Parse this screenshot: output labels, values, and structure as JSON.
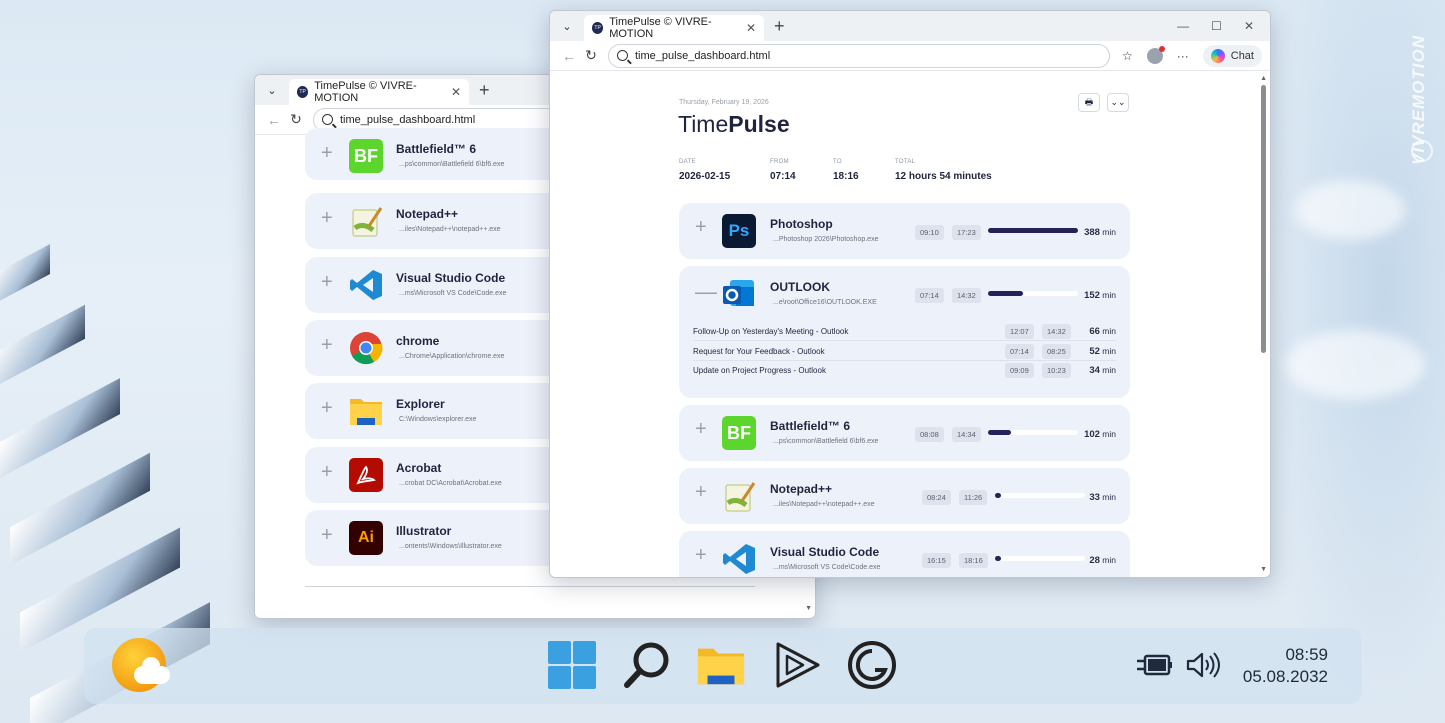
{
  "desktop": {
    "watermark": "VIVREMOTION"
  },
  "back_window": {
    "tab_title": "TimePulse © VIVRE-MOTION",
    "url": "time_pulse_dashboard.html",
    "apps": [
      {
        "name": "Battlefield™ 6",
        "path": "...ps\\common\\Battlefield 6\\bf6.exe",
        "icon": "battlefield-icon"
      },
      {
        "name": "Notepad++",
        "path": "...iles\\Notepad++\\notepad++.exe",
        "icon": "notepad-plus-plus-icon"
      },
      {
        "name": "Visual Studio Code",
        "path": "...ms\\Microsoft VS Code\\Code.exe",
        "icon": "vscode-icon"
      },
      {
        "name": "chrome",
        "path": "...Chrome\\Application\\chrome.exe",
        "icon": "chrome-icon"
      },
      {
        "name": "Explorer",
        "path": "C:\\Windows\\explorer.exe",
        "icon": "explorer-icon"
      },
      {
        "name": "Acrobat",
        "path": "...crobat DC\\Acrobat\\Acrobat.exe",
        "icon": "acrobat-icon"
      },
      {
        "name": "Illustrator",
        "path": "...ontents\\Windows\\Illustrator.exe",
        "icon": "illustrator-icon"
      }
    ]
  },
  "front_window": {
    "tab_title": "TimePulse © VIVRE-MOTION",
    "url": "time_pulse_dashboard.html",
    "chat_label": "Chat",
    "header": {
      "date_line": "Thursday, February 19, 2026",
      "title_light": "Time",
      "title_bold": "Pulse",
      "meta": [
        {
          "key": "DATE",
          "value": "2026-02-15"
        },
        {
          "key": "FROM",
          "value": "07:14"
        },
        {
          "key": "TO",
          "value": "18:16"
        },
        {
          "key": "TOTAL",
          "value": "12 hours 54 minutes"
        }
      ]
    },
    "apps": [
      {
        "name": "Photoshop",
        "path": "...Photoshop 2026\\Photoshop.exe",
        "start": "09:10",
        "end": "17:23",
        "minutes": "388",
        "fraction": 1.0,
        "expanded": false,
        "icon": "photoshop-icon"
      },
      {
        "name": "OUTLOOK",
        "path": "...e\\root\\Office16\\OUTLOOK.EXE",
        "start": "07:14",
        "end": "14:32",
        "minutes": "152",
        "fraction": 0.39,
        "expanded": true,
        "icon": "outlook-icon",
        "sessions": [
          {
            "title": "Follow-Up on Yesterday's Meeting - Outlook",
            "start": "12:07",
            "end": "14:32",
            "minutes": "66"
          },
          {
            "title": "Request for Your Feedback - Outlook",
            "start": "07:14",
            "end": "08:25",
            "minutes": "52"
          },
          {
            "title": "Update on Project Progress - Outlook",
            "start": "09:09",
            "end": "10:23",
            "minutes": "34"
          }
        ]
      },
      {
        "name": "Battlefield™ 6",
        "path": "...ps\\common\\Battlefield 6\\bf6.exe",
        "start": "08:08",
        "end": "14:34",
        "minutes": "102",
        "fraction": 0.26,
        "expanded": false,
        "icon": "battlefield-icon"
      },
      {
        "name": "Notepad++",
        "path": "...iles\\Notepad++\\notepad++.exe",
        "start": "08:24",
        "end": "11:26",
        "minutes": "33",
        "fraction": 0.05,
        "expanded": false,
        "icon": "notepad-plus-plus-icon"
      },
      {
        "name": "Visual Studio Code",
        "path": "...ms\\Microsoft VS Code\\Code.exe",
        "start": "16:15",
        "end": "18:16",
        "minutes": "28",
        "fraction": 0.04,
        "expanded": false,
        "icon": "vscode-icon"
      }
    ],
    "min_unit": "min"
  },
  "taskbar": {
    "icons": [
      "windows-start-icon",
      "search-icon",
      "file-explorer-icon",
      "media-player-icon",
      "elgato-icon"
    ],
    "time": "08:59",
    "date": "05.08.2032"
  }
}
